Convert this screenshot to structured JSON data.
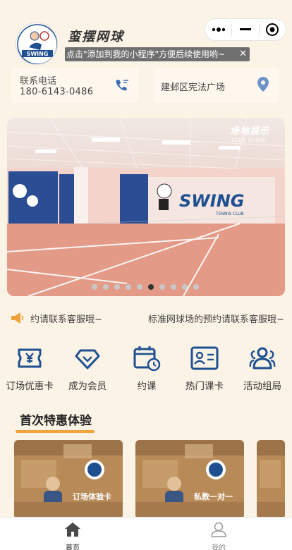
{
  "header": {
    "app_name": "蛮摆网球",
    "tip": "点击\"添加到我的小程序\"方便后续使用哟~",
    "tip_close": "✕",
    "logo_text": "SWING"
  },
  "contact": {
    "label": "联系电话",
    "phone": "180-6143-0486"
  },
  "address": {
    "text": "建邺区宪法广场"
  },
  "banner": {
    "title": "场地展示",
    "subtitle": "CLUB SHOW",
    "brand": "SWING",
    "brand_sub": "TENNIS CLUB",
    "dot_count": 10,
    "active_dot": 5
  },
  "notice": {
    "text_1": "约请联系客服哦~",
    "text_2": "标准网球场的预约请联系客服哦~"
  },
  "menu": [
    {
      "label": "订场优惠卡",
      "icon": "ticket-yen-icon"
    },
    {
      "label": "成为会员",
      "icon": "diamond-icon"
    },
    {
      "label": "约课",
      "icon": "calendar-clock-icon"
    },
    {
      "label": "热门课卡",
      "icon": "id-card-icon"
    },
    {
      "label": "活动组局",
      "icon": "group-icon"
    }
  ],
  "section": {
    "title": "首次特惠体验"
  },
  "promos": [
    {
      "label": "订场体验卡"
    },
    {
      "label": "私教一对一"
    }
  ],
  "tabbar": [
    {
      "label": "首页",
      "icon": "home-icon",
      "active": true
    },
    {
      "label": "我的",
      "icon": "user-icon",
      "active": false
    }
  ],
  "colors": {
    "accent": "#1d4f91",
    "bg": "#fbf3e5",
    "highlight": "#f2a33c",
    "court": "#e39a86"
  }
}
